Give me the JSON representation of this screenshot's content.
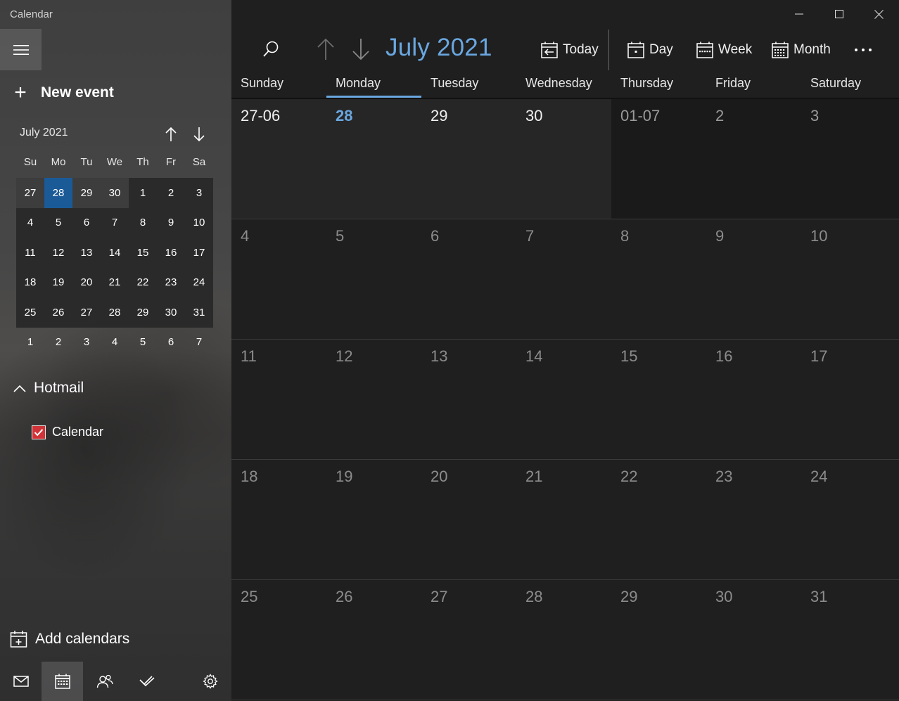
{
  "app": {
    "title": "Calendar"
  },
  "sidebar": {
    "new_event_label": "New event",
    "mini_calendar": {
      "title": "July 2021",
      "weekdays": [
        "Su",
        "Mo",
        "Tu",
        "We",
        "Th",
        "Fr",
        "Sa"
      ],
      "weeks": [
        [
          "27",
          "28",
          "29",
          "30",
          "1",
          "2",
          "3"
        ],
        [
          "4",
          "5",
          "6",
          "7",
          "8",
          "9",
          "10"
        ],
        [
          "11",
          "12",
          "13",
          "14",
          "15",
          "16",
          "17"
        ],
        [
          "18",
          "19",
          "20",
          "21",
          "22",
          "23",
          "24"
        ],
        [
          "25",
          "26",
          "27",
          "28",
          "29",
          "30",
          "31"
        ],
        [
          "1",
          "2",
          "3",
          "4",
          "5",
          "6",
          "7"
        ]
      ]
    },
    "account": {
      "name": "Hotmail",
      "calendars": [
        {
          "name": "Calendar",
          "checked": true,
          "color": "#d13438"
        }
      ]
    },
    "add_calendars_label": "Add calendars",
    "bottom_nav": [
      "mail-icon",
      "calendar-icon",
      "people-icon",
      "todo-icon",
      "settings-icon"
    ]
  },
  "toolbar": {
    "month_title": "July 2021",
    "today_label": "Today",
    "day_label": "Day",
    "week_label": "Week",
    "month_label": "Month"
  },
  "month_view": {
    "weekdays": [
      "Sunday",
      "Monday",
      "Tuesday",
      "Wednesday",
      "Thursday",
      "Friday",
      "Saturday"
    ],
    "weeks": [
      [
        "27-06",
        "28",
        "29",
        "30",
        "01-07",
        "2",
        "3"
      ],
      [
        "4",
        "5",
        "6",
        "7",
        "8",
        "9",
        "10"
      ],
      [
        "11",
        "12",
        "13",
        "14",
        "15",
        "16",
        "17"
      ],
      [
        "18",
        "19",
        "20",
        "21",
        "22",
        "23",
        "24"
      ],
      [
        "25",
        "26",
        "27",
        "28",
        "29",
        "30",
        "31"
      ]
    ]
  },
  "colors": {
    "accent": "#6aa7e0",
    "today_highlight": "#1a5a96",
    "calendar_color": "#d13438"
  }
}
